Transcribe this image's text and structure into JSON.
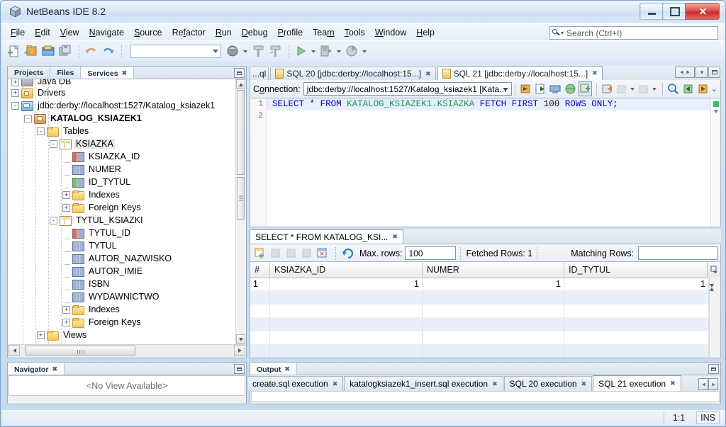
{
  "window": {
    "title": "NetBeans IDE 8.2",
    "app_icon": "netbeans-cube-icon",
    "buttons": {
      "minimize": "minimize-button",
      "maximize": "maximize-button",
      "close": "close-button"
    }
  },
  "menu": {
    "items": [
      {
        "label": "File",
        "mnemonic": "F"
      },
      {
        "label": "Edit",
        "mnemonic": "E"
      },
      {
        "label": "View",
        "mnemonic": "V"
      },
      {
        "label": "Navigate",
        "mnemonic": "N"
      },
      {
        "label": "Source",
        "mnemonic": "S"
      },
      {
        "label": "Refactor",
        "mnemonic": "R"
      },
      {
        "label": "Run",
        "mnemonic": "R"
      },
      {
        "label": "Debug",
        "mnemonic": "D"
      },
      {
        "label": "Profile",
        "mnemonic": "P"
      },
      {
        "label": "Team",
        "mnemonic": "m"
      },
      {
        "label": "Tools",
        "mnemonic": "T"
      },
      {
        "label": "Window",
        "mnemonic": "W"
      },
      {
        "label": "Help",
        "mnemonic": "H"
      }
    ]
  },
  "search": {
    "placeholder": "Search (Ctrl+I)",
    "value": "",
    "icon": "search-icon"
  },
  "toolbar": {
    "combo_value": "",
    "icons": [
      "new-file-icon",
      "new-project-icon",
      "open-project-icon",
      "save-all-icon",
      "undo-icon",
      "redo-icon",
      "build-project-icon",
      "clean-build-icon",
      "run-project-icon",
      "debug-project-icon",
      "profile-project-icon"
    ]
  },
  "left_panel": {
    "tabs": [
      {
        "label": "Projects",
        "active": false
      },
      {
        "label": "Files",
        "active": false
      },
      {
        "label": "Services",
        "active": true,
        "closable": true
      }
    ],
    "minimize_icon": "minimize-window-icon",
    "tree": [
      {
        "label": "Java DB",
        "depth": 1,
        "toggle": "+",
        "icon": "javadb-icon",
        "partial": true,
        "bold": false,
        "selected": false
      },
      {
        "label": "Drivers",
        "depth": 1,
        "toggle": "+",
        "icon": "drivers-folder-icon",
        "bold": false,
        "selected": false
      },
      {
        "label": "jdbc:derby://localhost:1527/Katalog_ksiazek1",
        "depth": 1,
        "toggle": "-",
        "icon": "database-connection-icon",
        "bold": false,
        "selected": false
      },
      {
        "label": "KATALOG_KSIAZEK1",
        "depth": 2,
        "toggle": "-",
        "icon": "schema-icon",
        "bold": true,
        "selected": false
      },
      {
        "label": "Tables",
        "depth": 3,
        "toggle": "-",
        "icon": "folder-icon",
        "bold": false,
        "selected": false
      },
      {
        "label": "KSIAZKA",
        "depth": 4,
        "toggle": "-",
        "icon": "table-icon",
        "bold": false,
        "selected": true
      },
      {
        "label": "KSIAZKA_ID",
        "depth": 5,
        "toggle": "",
        "icon": "primary-key-column-icon",
        "bold": false,
        "selected": false
      },
      {
        "label": "NUMER",
        "depth": 5,
        "toggle": "",
        "icon": "column-icon",
        "bold": false,
        "selected": false
      },
      {
        "label": "ID_TYTUL",
        "depth": 5,
        "toggle": "",
        "icon": "foreign-key-column-icon",
        "bold": false,
        "selected": false
      },
      {
        "label": "Indexes",
        "depth": 5,
        "toggle": "+",
        "icon": "folder-icon",
        "bold": false,
        "selected": false
      },
      {
        "label": "Foreign Keys",
        "depth": 5,
        "toggle": "+",
        "icon": "folder-icon",
        "bold": false,
        "selected": false
      },
      {
        "label": "TYTUL_KSIAZKI",
        "depth": 4,
        "toggle": "-",
        "icon": "table-icon",
        "bold": false,
        "selected": false
      },
      {
        "label": "TYTUL_ID",
        "depth": 5,
        "toggle": "",
        "icon": "primary-key-column-icon",
        "bold": false,
        "selected": false
      },
      {
        "label": "TYTUL",
        "depth": 5,
        "toggle": "",
        "icon": "column-icon",
        "bold": false,
        "selected": false
      },
      {
        "label": "AUTOR_NAZWISKO",
        "depth": 5,
        "toggle": "",
        "icon": "column-icon",
        "bold": false,
        "selected": false
      },
      {
        "label": "AUTOR_IMIE",
        "depth": 5,
        "toggle": "",
        "icon": "column-icon",
        "bold": false,
        "selected": false
      },
      {
        "label": "ISBN",
        "depth": 5,
        "toggle": "",
        "icon": "column-icon",
        "bold": false,
        "selected": false
      },
      {
        "label": "WYDAWNICTWO",
        "depth": 5,
        "toggle": "",
        "icon": "column-icon",
        "bold": false,
        "selected": false
      },
      {
        "label": "Indexes",
        "depth": 5,
        "toggle": "+",
        "icon": "folder-icon",
        "bold": false,
        "selected": false
      },
      {
        "label": "Foreign Keys",
        "depth": 5,
        "toggle": "+",
        "icon": "folder-icon",
        "bold": false,
        "selected": false
      },
      {
        "label": "Views",
        "depth": 3,
        "toggle": "+",
        "icon": "folder-icon",
        "bold": false,
        "selected": false
      }
    ]
  },
  "navigator": {
    "tab_label": "Navigator",
    "empty_text": "<No View Available>",
    "minimize_icon": "minimize-window-icon"
  },
  "editor": {
    "tabs": [
      {
        "label": "...ql",
        "active": false,
        "truncated": true
      },
      {
        "label": "SQL 20 [jdbc:derby://localhost:15...]",
        "active": false,
        "closable": true
      },
      {
        "label": "SQL 21 [jdbc:derby://localhost:15...]",
        "active": true,
        "closable": true
      }
    ],
    "tab_buttons": [
      "scroll-left-icon",
      "scroll-right-icon",
      "tab-list-icon",
      "maximize-window-icon"
    ],
    "connection_label": "Connection:",
    "connection_value": "jdbc:derby://localhost:1527/Katalog_ksiazek1 [Kata...",
    "sql_toolbar_icons": [
      "run-sql-icon",
      "run-current-statement-icon",
      "sql-history-icon",
      "toggle-autocommit-icon",
      "commit-icon",
      "rollback-icon",
      "previous-command-icon",
      "next-command-icon",
      "find-icon",
      "previous-result-icon",
      "next-result-icon",
      "more-options-icon"
    ],
    "gutter_lines": [
      "1",
      "2"
    ],
    "code": {
      "tokens": [
        {
          "t": "SELECT",
          "c": "kw"
        },
        {
          "t": " ",
          "c": "pun"
        },
        {
          "t": "*",
          "c": "pun"
        },
        {
          "t": " ",
          "c": "pun"
        },
        {
          "t": "FROM",
          "c": "kw"
        },
        {
          "t": " ",
          "c": "pun"
        },
        {
          "t": "KATALOG_KSIAZEK1.KSIAZKA",
          "c": "tbl"
        },
        {
          "t": " ",
          "c": "pun"
        },
        {
          "t": "FETCH",
          "c": "kw"
        },
        {
          "t": " ",
          "c": "pun"
        },
        {
          "t": "FIRST",
          "c": "kw"
        },
        {
          "t": " ",
          "c": "pun"
        },
        {
          "t": "100",
          "c": "num"
        },
        {
          "t": " ",
          "c": "pun"
        },
        {
          "t": "ROWS",
          "c": "kw"
        },
        {
          "t": " ",
          "c": "pun"
        },
        {
          "t": "ONLY",
          "c": "kw"
        },
        {
          "t": ";",
          "c": "pun"
        }
      ],
      "plain": "SELECT * FROM KATALOG_KSIAZEK1.KSIAZKA FETCH FIRST 100 ROWS ONLY;"
    }
  },
  "results": {
    "tab_label": "SELECT * FROM KATALOG_KSI...",
    "toolbar_icons": [
      "insert-record-icon",
      "delete-record-icon",
      "commit-record-icon",
      "cancel-edits-icon",
      "truncate-table-icon",
      "refresh-icon"
    ],
    "max_rows_label": "Max. rows:",
    "max_rows_value": "100",
    "fetched_rows_label": "Fetched Rows: 1",
    "matching_rows_label": "Matching Rows:",
    "matching_rows_value": "",
    "columns": [
      "#",
      "KSIAZKA_ID",
      "NUMER",
      "ID_TYTUL"
    ],
    "rows": [
      [
        "1",
        "1",
        "1",
        "1"
      ]
    ],
    "empty_row_count": 5,
    "grid_corner_icon": "column-settings-icon"
  },
  "output": {
    "tab_label": "Output",
    "minimize_icon": "minimize-window-icon",
    "tabs": [
      {
        "label": "create.sql execution",
        "active": false,
        "closable": true
      },
      {
        "label": "katalogksiazek1_insert.sql execution",
        "active": false,
        "closable": true
      },
      {
        "label": "SQL 20 execution",
        "active": false,
        "closable": true
      },
      {
        "label": "SQL 21 execution",
        "active": true,
        "closable": true
      }
    ],
    "nav_icons": [
      "scroll-left-icon",
      "scroll-right-icon"
    ]
  },
  "status": {
    "caret_position": "1:1",
    "insert_mode": "INS"
  },
  "colors": {
    "keyword": "#0000c8",
    "table_name": "#1a9a4a",
    "selection_line": "#e8eefc",
    "alt_row": "#e9eefb",
    "accent": "#7ca2c8",
    "close_button": "#c62d28"
  }
}
